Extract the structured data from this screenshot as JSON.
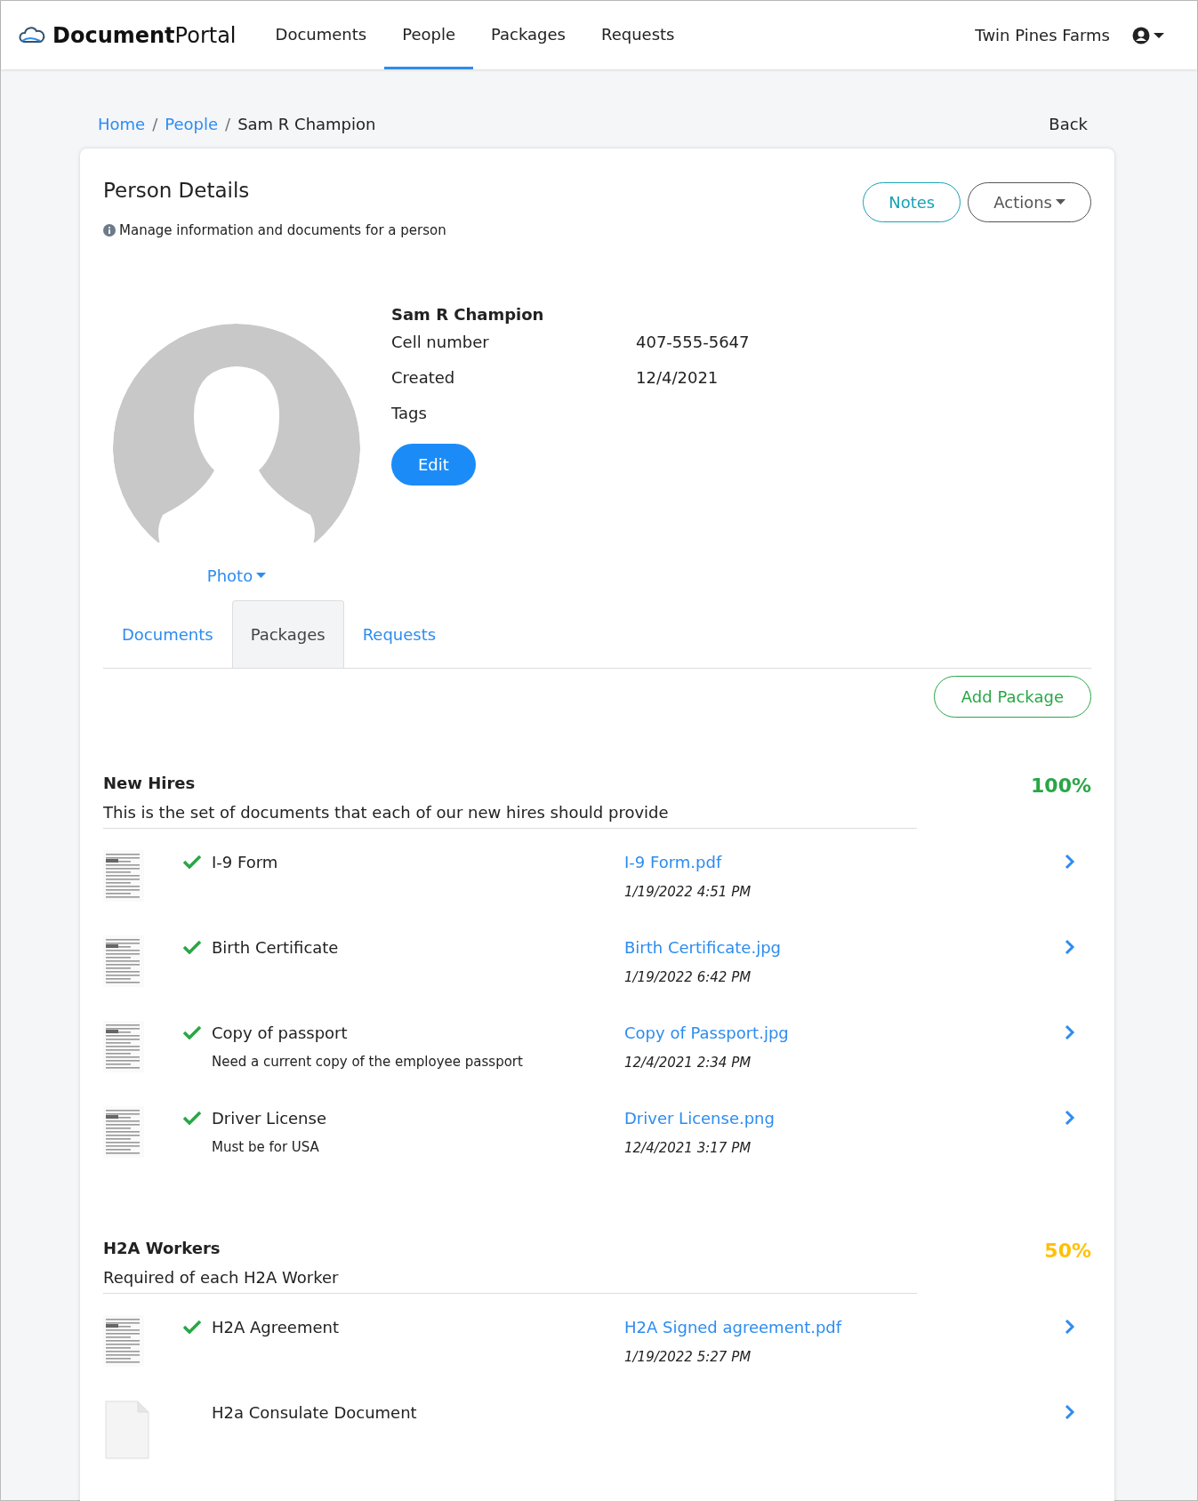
{
  "navbar": {
    "brand_bold": "Document",
    "brand_rest": "Portal",
    "links": [
      {
        "label": "Documents",
        "selected": false
      },
      {
        "label": "People",
        "selected": true
      },
      {
        "label": "Packages",
        "selected": false
      },
      {
        "label": "Requests",
        "selected": false
      }
    ],
    "account": "Twin Pines Farms"
  },
  "breadcrumb": [
    {
      "label": "Home"
    },
    {
      "separator": "/",
      "label": "People"
    },
    {
      "separator": "/",
      "label": "Sam R Champion"
    }
  ],
  "back": "Back",
  "card": {
    "title": "Person Details",
    "subtitle": "Manage information and documents for a person",
    "buttons": [
      "Notes",
      "Actions"
    ]
  },
  "person": {
    "name": "Sam R Champion",
    "fields": [
      {
        "label": "Cell number",
        "value": "407-555-5647"
      },
      {
        "label": "Created",
        "value": "12/4/2021"
      },
      {
        "label": "Tags"
      }
    ],
    "edit": "Edit",
    "photo": "Photo"
  },
  "tabs": [
    {
      "label": "Documents",
      "selected": false
    },
    {
      "label": "Packages",
      "selected": true
    },
    {
      "label": "Requests",
      "selected": false
    }
  ],
  "add_package": "Add Package",
  "packages": [
    {
      "name": "New Hires",
      "percent": "100%",
      "color": "#28a745",
      "description": "This is the set of documents that each of our new hires should provide",
      "items": [
        {
          "kind": "scan",
          "checked": true,
          "name": "I-9 Form",
          "file": "I-9 Form.pdf",
          "date": "1/19/2022 4:51 PM"
        },
        {
          "kind": "scan",
          "checked": true,
          "name": "Birth Certificate",
          "file": "Birth Certificate.jpg",
          "date": "1/19/2022 6:42 PM"
        },
        {
          "kind": "scan",
          "checked": true,
          "name": "Copy of passport",
          "note": "Need a current copy of the employee passport",
          "file": "Copy of Passport.jpg",
          "date": "12/4/2021 2:34 PM"
        },
        {
          "kind": "scan",
          "checked": true,
          "name": "Driver License",
          "note": "Must be for USA",
          "file": "Driver License.png",
          "date": "12/4/2021 3:17 PM"
        }
      ]
    },
    {
      "name": "H2A Workers",
      "percent": "50%",
      "color": "#ffc107",
      "description": "Required of each H2A Worker",
      "items": [
        {
          "kind": "scan",
          "checked": true,
          "name": "H2A Agreement",
          "file": "H2A Signed agreement.pdf",
          "date": "1/19/2022 5:27 PM"
        },
        {
          "kind": "blank",
          "checked": false,
          "name": "H2a Consulate Document"
        }
      ]
    }
  ]
}
